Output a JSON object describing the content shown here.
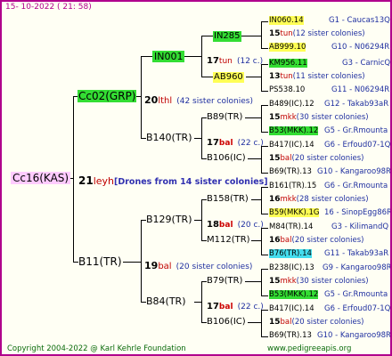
{
  "header": {
    "date": "15- 10-2022",
    "time": "( 21: 58)"
  },
  "root": {
    "label": "Cc16(KAS)",
    "number": "21",
    "sub": "leyh",
    "note": "[Drones from 14 sister colonies]"
  },
  "father": {
    "label": "Cc02(GRP)",
    "number": "20",
    "sub": "lthl",
    "note": "(42 sister colonies)"
  },
  "mother": {
    "label": "B11(TR)",
    "number": "19",
    "sub": "bal",
    "note": "(20 sister colonies)"
  },
  "gen3": {
    "in001": {
      "label": "IN001",
      "number": "17",
      "sub": "tun",
      "note": "(12 c.)"
    },
    "b140": {
      "label": "B140(TR)"
    },
    "b129": {
      "label": "B129(TR)",
      "number": "18",
      "sub": "bal",
      "note": "(20 c.)"
    },
    "b84": {
      "label": "B84(TR)",
      "number": "17",
      "sub": "bal",
      "note": "(22 c.)"
    }
  },
  "gen4": {
    "in285": {
      "label": "IN285"
    },
    "ab960": {
      "label": "AB960"
    },
    "b89": {
      "label": "B89(TR)",
      "number": "17",
      "sub": "bal",
      "note": "(22 c.)"
    },
    "b106a": {
      "label": "B106(IC)"
    },
    "b158": {
      "label": "B158(TR)"
    },
    "m112": {
      "label": "M112(TR)"
    },
    "b79": {
      "label": "B79(TR)"
    },
    "b106b": {
      "label": "B106(IC)"
    }
  },
  "rows": [
    {
      "name": "IN060.14",
      "num": "15",
      "sub": "tun",
      "note": "",
      "info": "G1 - Caucas13Q"
    },
    {
      "name": "",
      "num": "",
      "sub": "",
      "note": "(12 sister colonies)",
      "info": ""
    },
    {
      "name": "AB999.10",
      "num": "",
      "sub": "",
      "note": "",
      "info": "G10 - N06294R"
    },
    {
      "name": "KM956.11",
      "num": "",
      "sub": "",
      "note": "",
      "info": "G3 - CarnicQ"
    },
    {
      "name": "",
      "num": "13",
      "sub": "tun",
      "note": "(11 sister colonies)",
      "info": ""
    },
    {
      "name": "PS538.10",
      "num": "",
      "sub": "",
      "note": "",
      "info": "G11 - N06294R"
    },
    {
      "name": "B489(IC).12",
      "num": "",
      "sub": "",
      "note": "",
      "info": "G12 - Takab93aR"
    },
    {
      "name": "",
      "num": "15",
      "sub": "mkk",
      "note": "(30 sister colonies)",
      "info": ""
    },
    {
      "name": "B53(MKK).12",
      "num": "",
      "sub": "",
      "note": "",
      "info": "G5 - Gr.Rmounta"
    },
    {
      "name": "B417(IC).14",
      "num": "",
      "sub": "",
      "note": "",
      "info": "G6 - Erfoud07-1Q"
    },
    {
      "name": "",
      "num": "15",
      "sub": "bal",
      "note": "(20 sister colonies)",
      "info": ""
    },
    {
      "name": "B69(TR).13",
      "num": "",
      "sub": "",
      "note": "",
      "info": "G10 - Kangaroo98R"
    },
    {
      "name": "B161(TR).15",
      "num": "",
      "sub": "",
      "note": "",
      "info": "G6 - Gr.Rmounta"
    },
    {
      "name": "",
      "num": "16",
      "sub": "mkk",
      "note": "(28 sister colonies)",
      "info": ""
    },
    {
      "name": "B59(MKK).1G",
      "num": "",
      "sub": "",
      "note": "",
      "info": "16 - SinopEgg86R"
    },
    {
      "name": "M84(TR).14",
      "num": "",
      "sub": "",
      "note": "",
      "info": "G3 - KilimandQ"
    },
    {
      "name": "",
      "num": "16",
      "sub": "bal",
      "note": "(20 sister colonies)",
      "info": ""
    },
    {
      "name": "B76(TR).14",
      "num": "",
      "sub": "",
      "note": "",
      "info": "G11 - Takab93aR"
    },
    {
      "name": "B238(IC).13",
      "num": "",
      "sub": "",
      "note": "",
      "info": "G9 - Kangaroo98R"
    },
    {
      "name": "",
      "num": "15",
      "sub": "mkk",
      "note": "(30 sister colonies)",
      "info": ""
    },
    {
      "name": "B53(MKK).12",
      "num": "",
      "sub": "",
      "note": "",
      "info": "G5 - Gr.Rmounta"
    },
    {
      "name": "B417(IC).14",
      "num": "",
      "sub": "",
      "note": "",
      "info": "G6 - Erfoud07-1Q"
    },
    {
      "name": "",
      "num": "15",
      "sub": "bal",
      "note": "(20 sister colonies)",
      "info": ""
    },
    {
      "name": "B69(TR).13",
      "num": "",
      "sub": "",
      "note": "",
      "info": "G10 - Kangaroo98R"
    }
  ],
  "footer": {
    "copyright": "Copyright 2004-2022 @ Karl Kehrle Foundation",
    "site": "www.pedigreeapis.org"
  },
  "colors": {
    "border": "#b0008c",
    "green": "#33dd33",
    "yellow": "#ffff55",
    "cyan": "#44ddee",
    "pink": "#ffccff",
    "footer": "#0a6a0a",
    "info": "#2030a0",
    "red": "#cc0000"
  }
}
